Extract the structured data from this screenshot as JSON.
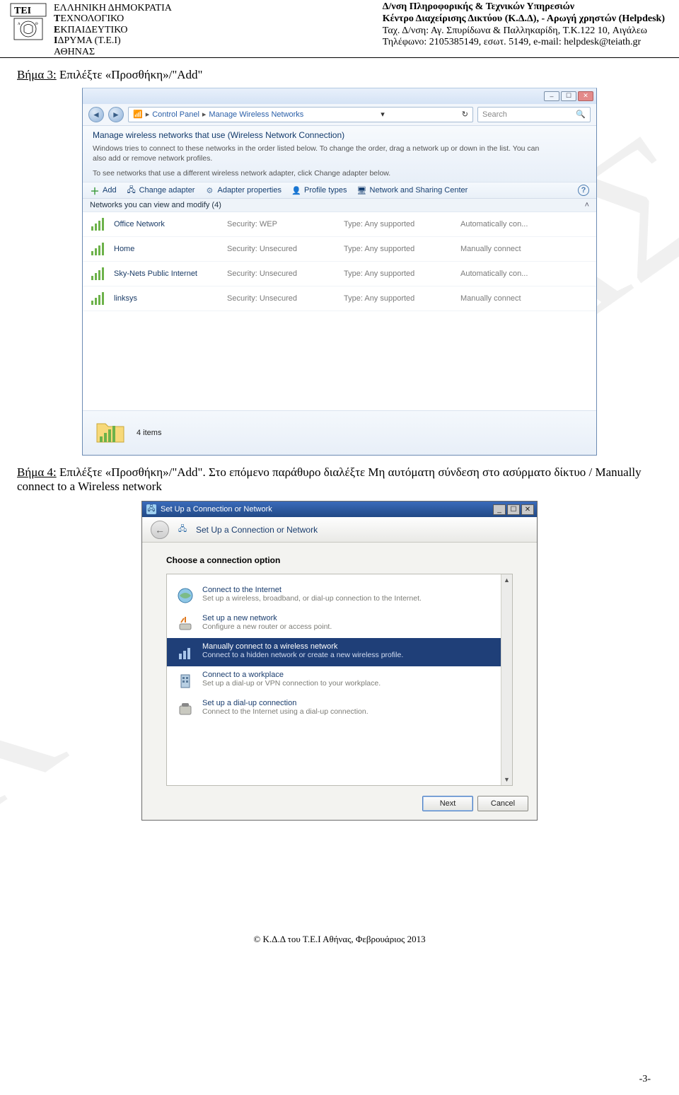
{
  "header": {
    "org_line1": "ΕΛΛΗΝΙΚΗ ΔΗΜΟΚΡΑΤΙΑ",
    "org_line2_pre": "Τ",
    "org_line2_rest": "ΕΧΝΟΛΟΓΙΚΟ",
    "org_line3_pre": "Ε",
    "org_line3_rest": "ΚΠΑΙΔΕΥΤΙΚΟ",
    "org_line4_pre": "Ι",
    "org_line4_rest": "ΔΡΥΜΑ (Τ.Ε.Ι)",
    "org_line5": "ΑΘΗΝΑΣ",
    "r1": "Δ/νση Πληροφορικής & Τεχνικών Υπηρεσιών",
    "r2": "Κέντρο Διαχείρισης Δικτύου (Κ.Δ.Δ), - Αρωγή χρηστών (Helpdesk)",
    "r3a": "Ταχ. Δ/νση: Αγ. Σπυρίδωνα & Παλληκαρίδη, T.K.122 10, Αιγάλεω",
    "r4a": "Τηλέφωνο: 2105385149, εσωτ. 5149,  e-mail: helpdesk@teiath.gr"
  },
  "step3_label": "Βήμα 3:",
  "step3_text": " Επιλέξτε «Προσθήκη»/\"Add\"",
  "step4_label": "Βήμα 4:",
  "step4_text": " Επιλέξτε «Προσθήκη»/\"Add\". Στο επόμενο παράθυρο διαλέξτε Μη αυτόματη σύνδεση στο ασύρματο δίκτυο / Manually connect to a Wireless network",
  "win7": {
    "breadcrumb1": "Control Panel",
    "breadcrumb2": "Manage Wireless Networks",
    "search_placeholder": "Search",
    "title": "Manage wireless networks that use (Wireless Network Connection)",
    "desc": "Windows tries to connect to these networks in the order listed below. To change the order, drag a network up or down in the list. You can also add or remove network profiles.",
    "desc2": "To see networks that use a different wireless network adapter, click Change adapter below.",
    "tb_add": "Add",
    "tb_change": "Change adapter",
    "tb_props": "Adapter properties",
    "tb_profile": "Profile types",
    "tb_nsc": "Network and Sharing Center",
    "subhdr": "Networks you can view and modify (4)",
    "rows": [
      {
        "name": "Office Network",
        "sec": "Security: WEP",
        "type": "Type: Any supported",
        "mode": "Automatically con..."
      },
      {
        "name": "Home",
        "sec": "Security: Unsecured",
        "type": "Type: Any supported",
        "mode": "Manually connect"
      },
      {
        "name": "Sky-Nets Public Internet",
        "sec": "Security: Unsecured",
        "type": "Type: Any supported",
        "mode": "Automatically con..."
      },
      {
        "name": "linksys",
        "sec": "Security: Unsecured",
        "type": "Type: Any supported",
        "mode": "Manually connect"
      }
    ],
    "status_items": "4 items"
  },
  "setup": {
    "titlebar": "Set Up a Connection or Network",
    "subhead": "Set Up a Connection or Network",
    "choose": "Choose a connection option",
    "opts": [
      {
        "t": "Connect to the Internet",
        "d": "Set up a wireless, broadband, or dial-up connection to the Internet."
      },
      {
        "t": "Set up a new network",
        "d": "Configure a new router or access point."
      },
      {
        "t": "Manually connect to a wireless network",
        "d": "Connect to a hidden network or create a new wireless profile."
      },
      {
        "t": "Connect to a workplace",
        "d": "Set up a dial-up or VPN connection to your workplace."
      },
      {
        "t": "Set up a dial-up connection",
        "d": "Connect to the Internet using a dial-up connection."
      }
    ],
    "next": "Next",
    "cancel": "Cancel"
  },
  "footer": "© Κ.Δ.Δ του Τ.Ε.Ι Αθήνας, Φεβρουάριος 2013",
  "pagenum": "-3-",
  "watermark1": "ΝΑΣ",
  "watermark2": "Κ"
}
